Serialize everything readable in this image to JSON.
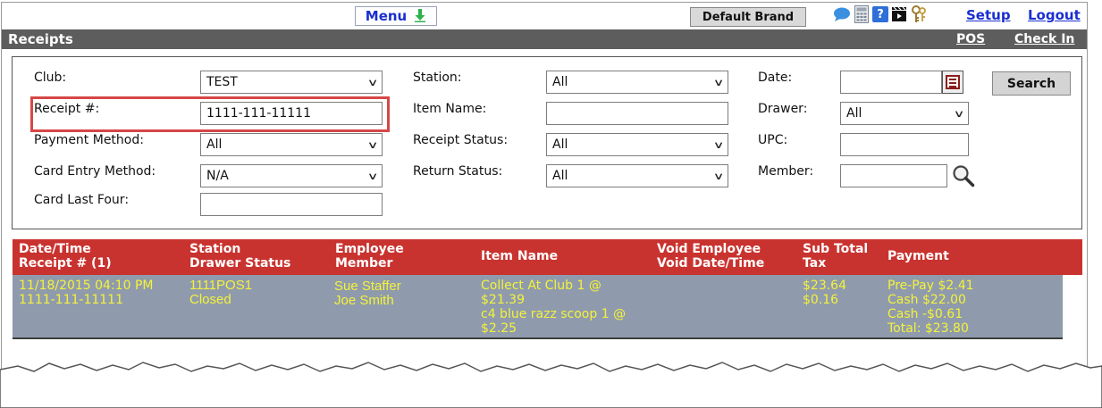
{
  "topbar": {
    "menu_label": "Menu",
    "brand_label": "Default Brand",
    "setup_label": "Setup",
    "logout_label": "Logout"
  },
  "titlebar": {
    "title": "Receipts",
    "pos_label": "POS",
    "checkin_label": "Check In"
  },
  "search": {
    "club": {
      "label": "Club:",
      "value": "TEST"
    },
    "receipt": {
      "label": "Receipt #:",
      "value": "1111-111-11111"
    },
    "payment_method": {
      "label": "Payment Method:",
      "value": "All"
    },
    "card_entry": {
      "label": "Card Entry Method:",
      "value": "N/A"
    },
    "card_last_four": {
      "label": "Card Last Four:",
      "value": ""
    },
    "station": {
      "label": "Station:",
      "value": "All"
    },
    "item_name": {
      "label": "Item Name:",
      "value": ""
    },
    "receipt_status": {
      "label": "Receipt Status:",
      "value": "All"
    },
    "return_status": {
      "label": "Return Status:",
      "value": "All"
    },
    "date": {
      "label": "Date:",
      "value": ""
    },
    "drawer": {
      "label": "Drawer:",
      "value": "All"
    },
    "upc": {
      "label": "UPC:",
      "value": ""
    },
    "member": {
      "label": "Member:",
      "value": ""
    },
    "search_button": "Search"
  },
  "table": {
    "headers": {
      "datetime": [
        "Date/Time",
        "Receipt # (1)"
      ],
      "station": [
        "Station",
        "Drawer Status"
      ],
      "employee": [
        "Employee",
        "Member"
      ],
      "item": [
        "Item Name"
      ],
      "void": [
        "Void Employee",
        "Void Date/Time"
      ],
      "subtotal": [
        "Sub Total",
        "Tax"
      ],
      "payment": [
        "Payment"
      ]
    },
    "rows": [
      {
        "datetime": "11/18/2015 04:10 PM",
        "receipt": "1111-111-11111",
        "station": "1111POS1",
        "drawer_status": "Closed",
        "employee": "Sue Staffer",
        "member": "Joe Smith",
        "items": [
          "Collect At Club 1 @",
          "$21.39",
          "c4 blue razz scoop 1 @",
          "$2.25"
        ],
        "subtotal": "$23.64",
        "tax": "$0.16",
        "payments": [
          "Pre-Pay $2.41",
          "Cash $22.00",
          "Cash -$0.61",
          "Total: $23.80"
        ]
      }
    ]
  },
  "colors": {
    "header_red": "#c9332f",
    "row_gray": "#8f9bac",
    "row_text_yellow": "#f4f23a",
    "titlebar_gray": "#5d5d5d",
    "link_blue": "#1a2fd0",
    "highlight_red": "#d64747"
  },
  "icons": [
    "chat-icon",
    "calculator-icon",
    "help-icon",
    "clapper-icon",
    "keys-icon",
    "calendar-icon",
    "magnifier-icon",
    "download-arrow-icon"
  ]
}
